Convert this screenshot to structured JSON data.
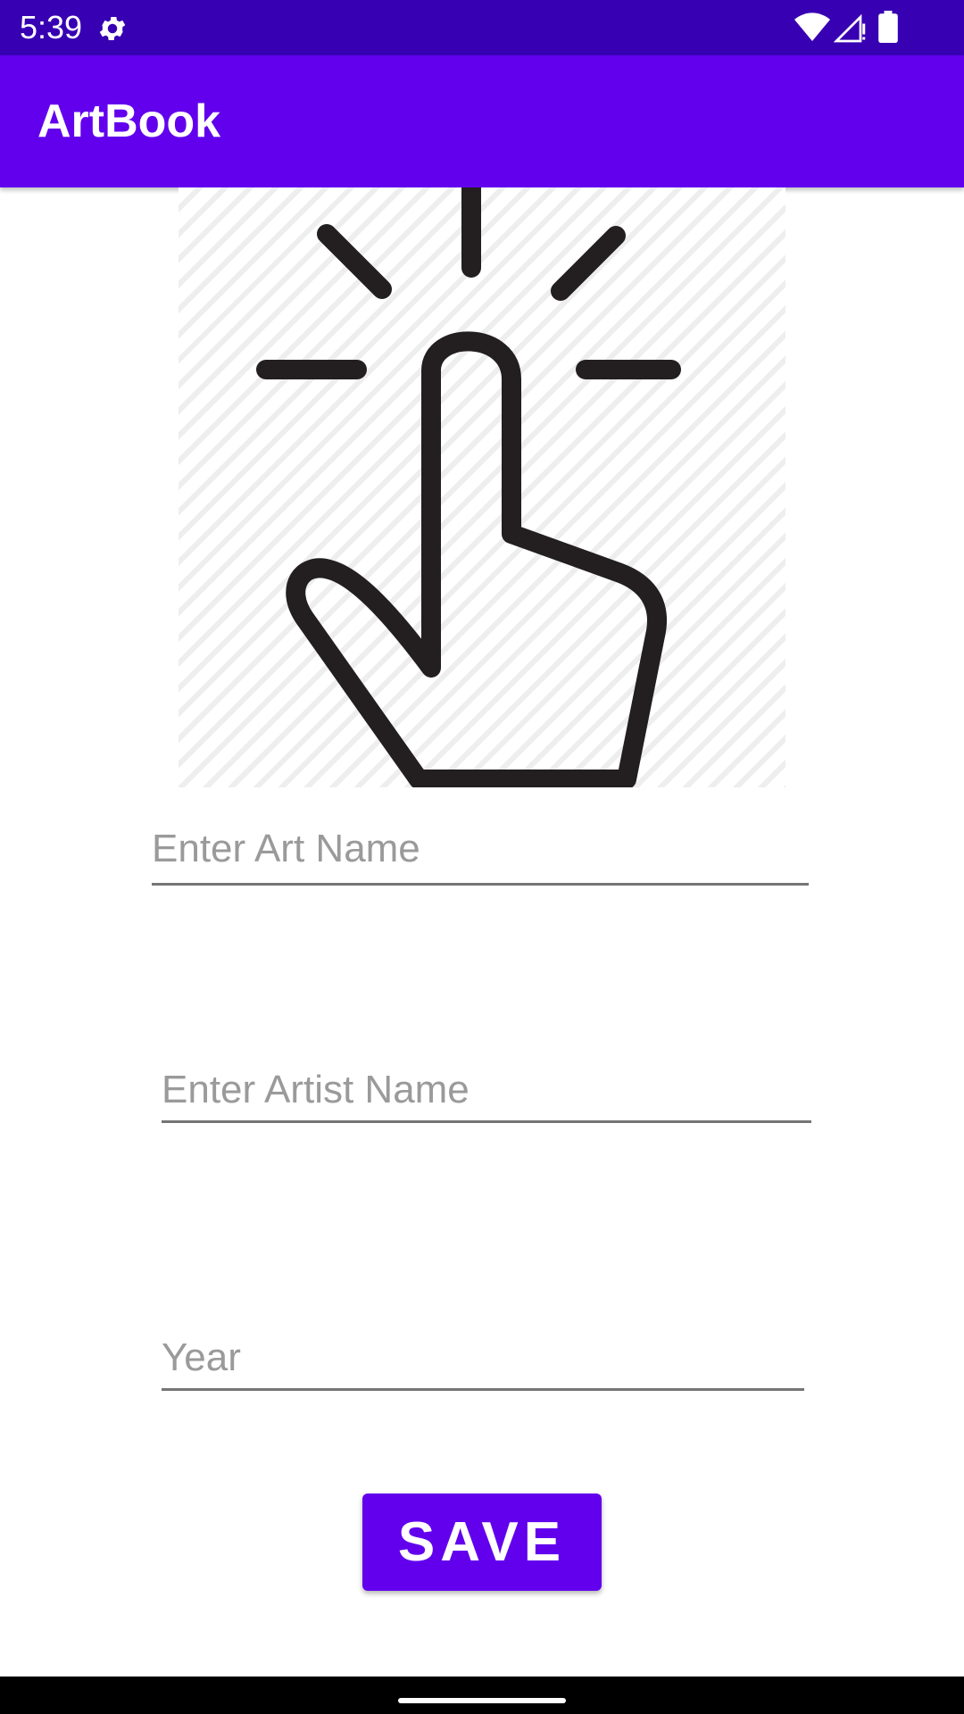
{
  "status_bar": {
    "time": "5:39",
    "icons": [
      "gear-icon",
      "wifi-icon",
      "signal-icon",
      "battery-icon"
    ],
    "background": "#3700B3"
  },
  "app_bar": {
    "title": "ArtBook",
    "background": "#6200EE"
  },
  "image_select": {
    "icon": "tap-hand-icon"
  },
  "form": {
    "art_name_placeholder": "Enter Art Name",
    "artist_name_placeholder": "Enter Artist Name",
    "year_placeholder": "Year"
  },
  "save_button": {
    "label": "SAVE",
    "color": "#6200EE"
  }
}
